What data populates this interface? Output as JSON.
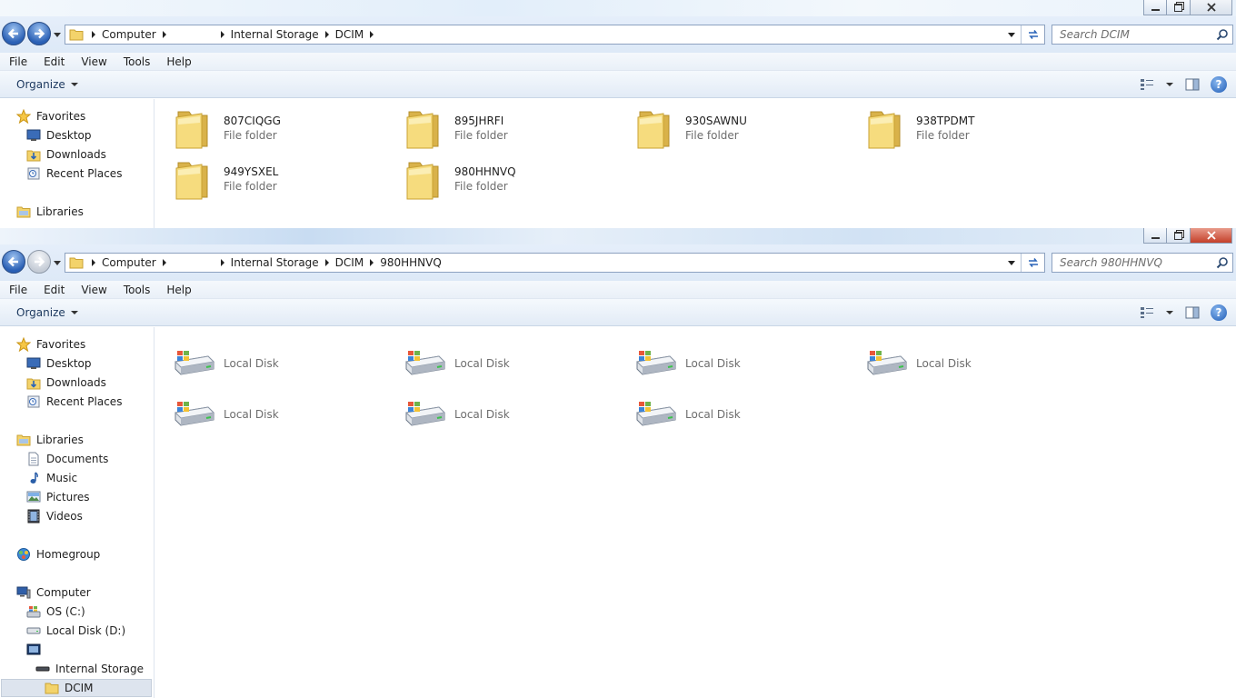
{
  "win1": {
    "breadcrumb": [
      "Computer",
      "",
      "Internal Storage",
      "DCIM"
    ],
    "search_placeholder": "Search DCIM",
    "menu": [
      "File",
      "Edit",
      "View",
      "Tools",
      "Help"
    ],
    "organize": "Organize",
    "nav": {
      "favorites": "Favorites",
      "desktop": "Desktop",
      "downloads": "Downloads",
      "recent": "Recent Places",
      "libraries": "Libraries"
    },
    "folders": [
      {
        "name": "807CIQGG",
        "type": "File folder"
      },
      {
        "name": "895JHRFI",
        "type": "File folder"
      },
      {
        "name": "930SAWNU",
        "type": "File folder"
      },
      {
        "name": "938TPDMT",
        "type": "File folder"
      },
      {
        "name": "949YSXEL",
        "type": "File folder"
      },
      {
        "name": "980HHNVQ",
        "type": "File folder"
      }
    ]
  },
  "win2": {
    "breadcrumb": [
      "Computer",
      "",
      "Internal Storage",
      "DCIM",
      "980HHNVQ"
    ],
    "search_placeholder": "Search 980HHNVQ",
    "menu": [
      "File",
      "Edit",
      "View",
      "Tools",
      "Help"
    ],
    "organize": "Organize",
    "nav": {
      "favorites": "Favorites",
      "desktop": "Desktop",
      "downloads": "Downloads",
      "recent": "Recent Places",
      "libraries": "Libraries",
      "documents": "Documents",
      "music": "Music",
      "pictures": "Pictures",
      "videos": "Videos",
      "homegroup": "Homegroup",
      "computer": "Computer",
      "osc": "OS (C:)",
      "locald": "Local Disk (D:)",
      "device": "",
      "internal": "Internal Storage",
      "dcim": "DCIM"
    },
    "disks": [
      "Local Disk",
      "Local Disk",
      "Local Disk",
      "Local Disk",
      "Local Disk",
      "Local Disk",
      "Local Disk"
    ]
  },
  "icons": {
    "folder": "folder-icon",
    "disk": "hard-disk-icon",
    "star": "favorites-star-icon",
    "help": "help-icon"
  },
  "colors": {
    "accent": "#2a60b5",
    "folder": "#f3d36b",
    "close": "#c4402a"
  }
}
